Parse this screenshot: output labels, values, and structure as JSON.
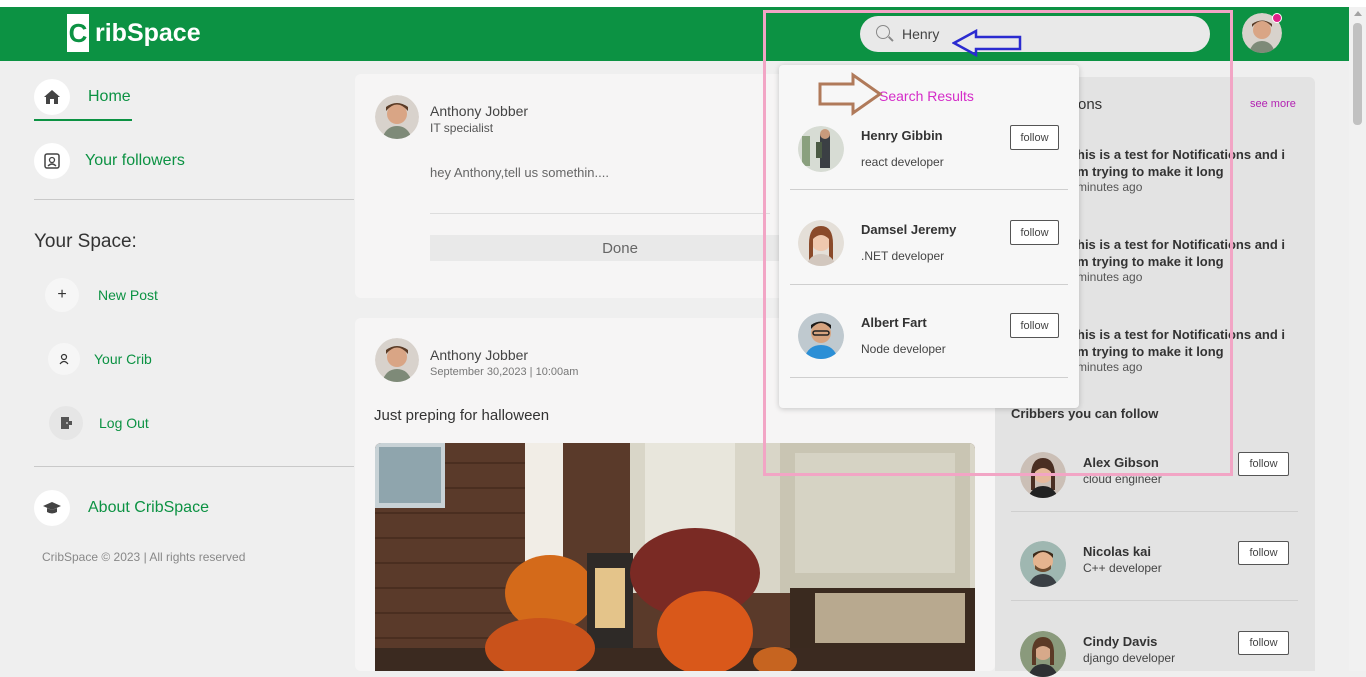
{
  "app": {
    "logo_letter": "C",
    "logo_text": "ribSpace"
  },
  "search": {
    "value": "Henry",
    "placeholder": ""
  },
  "sidebar": {
    "home": "Home",
    "followers": "Your followers",
    "space_title": "Your Space:",
    "new_post": "New Post",
    "your_crib": "Your Crib",
    "log_out": "Log Out",
    "about": "About CribSpace",
    "footer": "CribSpace © 2023 | All rights reserved"
  },
  "composer": {
    "name": "Anthony Jobber",
    "title": "IT specialist",
    "placeholder": "hey Anthony,tell us somethin....",
    "done_label": "Done"
  },
  "post": {
    "name": "Anthony Jobber",
    "date": "September 30,2023 | 10:00am",
    "text": "Just preping for halloween"
  },
  "notifications": {
    "title_partial": "ons",
    "see_more": "see more",
    "items": [
      {
        "line1": "his is a test for Notifications and i",
        "line2": "m trying to make it long",
        "time": "minutes ago"
      },
      {
        "line1": "his is a test for Notifications and i",
        "line2": "m trying to make it long",
        "time": "minutes ago"
      },
      {
        "line1": "his is a test for Notifications and i",
        "line2": "m trying to make it long",
        "time": "minutes ago"
      }
    ]
  },
  "cribbers": {
    "title": "Cribbers you can follow",
    "items": [
      {
        "name": "Alex Gibson",
        "role": "cloud engineer",
        "action": "follow"
      },
      {
        "name": "Nicolas kai",
        "role": "C++ developer",
        "action": "follow"
      },
      {
        "name": "Cindy Davis",
        "role": "django developer",
        "action": "follow"
      }
    ]
  },
  "search_results": {
    "title": "Search Results",
    "items": [
      {
        "name": "Henry Gibbin",
        "role": "react developer",
        "action": "follow"
      },
      {
        "name": "Damsel Jeremy",
        "role": ".NET developer",
        "action": "follow"
      },
      {
        "name": "Albert Fart",
        "role": "Node developer",
        "action": "follow"
      }
    ]
  },
  "colors": {
    "brand": "#0c9243",
    "accent": "#d42cc8",
    "highlight_box": "#f2a5c5",
    "arrow_blue": "#2b2bd0",
    "arrow_brown": "#b07a5a"
  }
}
